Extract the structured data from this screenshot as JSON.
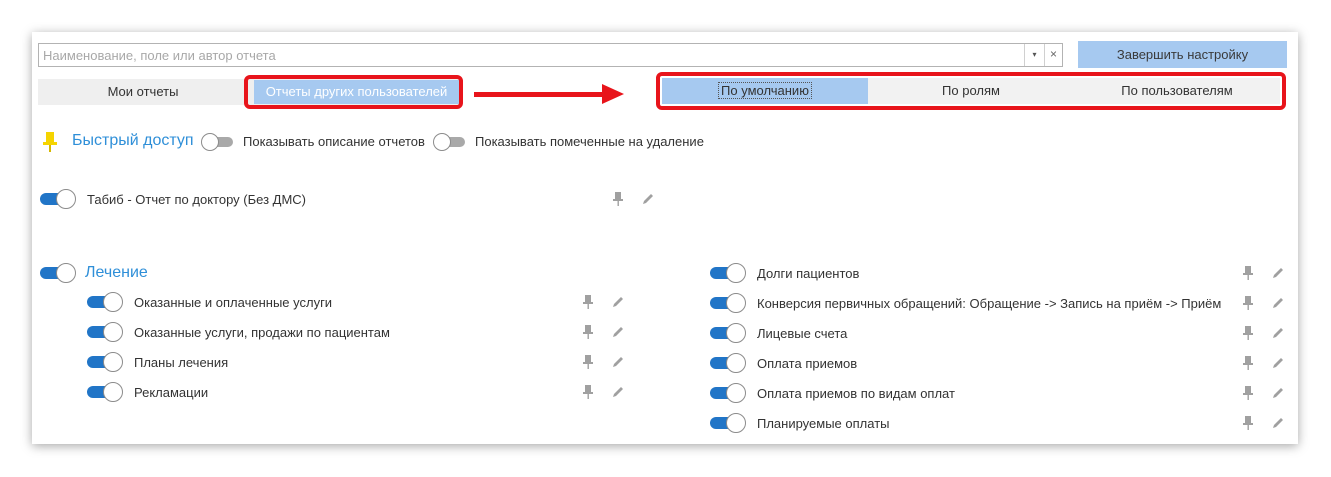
{
  "search": {
    "placeholder": "Наименование, поле или автор отчета",
    "dropdown_glyph": "▾",
    "clear_glyph": "×"
  },
  "finish_button": "Завершить настройку",
  "owner_tabs": {
    "mine": "Мои отчеты",
    "others": "Отчеты других пользователей",
    "selected": "others"
  },
  "view_tabs": {
    "default": "По умолчанию",
    "roles": "По ролям",
    "users": "По пользователям",
    "selected": "default"
  },
  "quick_access": {
    "title": "Быстрый доступ",
    "show_descriptions": "Показывать описание отчетов",
    "show_marked_deleted": "Показывать помеченные на удаление",
    "items": [
      "Табиб - Отчет по доктору (Без ДМС)"
    ]
  },
  "sections": {
    "treatment": {
      "title": "Лечение",
      "left_items": [
        "Оказанные и оплаченные услуги",
        "Оказанные услуги, продажи по пациентам",
        "Планы лечения",
        "Рекламации"
      ],
      "right_items": [
        "Долги пациентов",
        "Конверсия первичных обращений:  Обращение -> Запись на приём -> Приём",
        "Лицевые счета",
        "Оплата приемов",
        "Оплата приемов по видам оплат",
        "Планируемые оплаты"
      ]
    }
  },
  "colors": {
    "accent": "#2f8fd8",
    "selected_tab": "#a6c9f0",
    "toggle_on": "#2175c7",
    "highlight": "#e8141b",
    "pin_quick": "#f5d400"
  }
}
